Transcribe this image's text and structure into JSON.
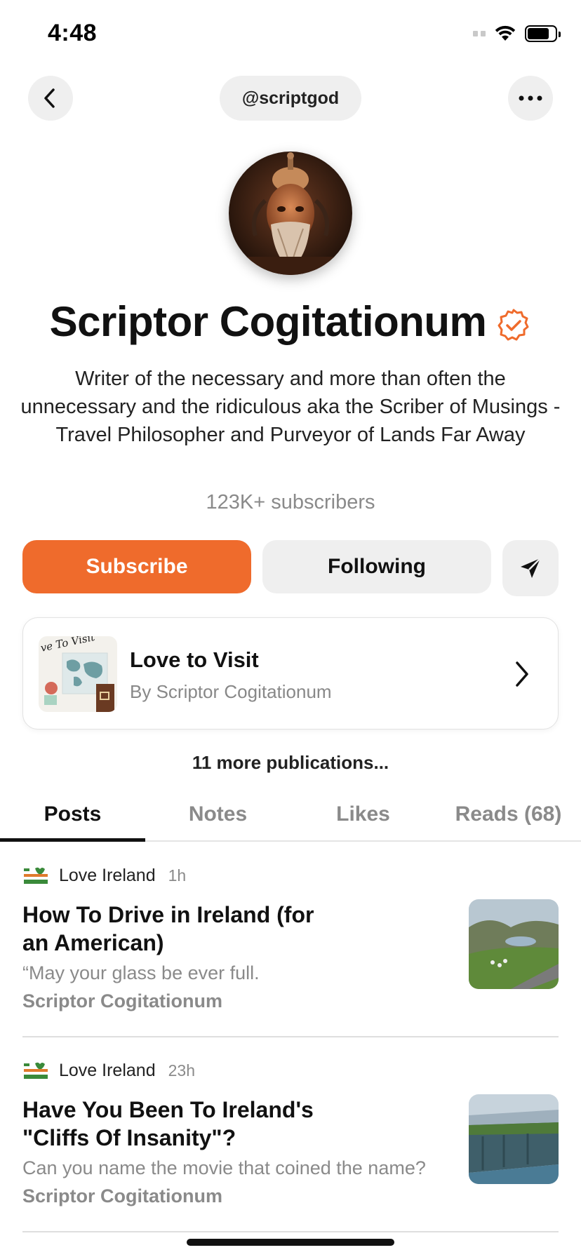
{
  "status_bar": {
    "time": "4:48"
  },
  "nav": {
    "handle": "@scriptgod"
  },
  "profile": {
    "name": "Scriptor Cogitationum",
    "bio": "Writer of the necessary and more than often the unnecessary and the ridiculous aka the Scriber of Musings - Travel Philosopher and Purveyor of Lands Far Away",
    "subscribers": "123K+ subscribers"
  },
  "actions": {
    "subscribe": "Subscribe",
    "following": "Following"
  },
  "publication": {
    "title": "Love to Visit",
    "byline": "By Scriptor Cogitationum",
    "thumb_text": "ve To Visit"
  },
  "more_publications": "11 more publications...",
  "tabs": [
    {
      "label": "Posts"
    },
    {
      "label": "Notes"
    },
    {
      "label": "Likes"
    },
    {
      "label": "Reads (68)"
    }
  ],
  "posts": [
    {
      "publication": "Love Ireland",
      "time": "1h",
      "title": "How To Drive in Ireland (for an American)",
      "subtitle": "“May your glass be ever full.",
      "author": "Scriptor Cogitationum"
    },
    {
      "publication": "Love Ireland",
      "time": "23h",
      "title": "Have You Been To Ireland's \"Cliffs Of Insanity\"?",
      "subtitle": "Can you name the movie that coined the name?",
      "author": "Scriptor Cogitationum"
    }
  ],
  "colors": {
    "accent": "#ef6b2c",
    "pill": "#efefef",
    "muted": "#8a8a8a"
  },
  "icons": [
    "back-chevron-icon",
    "more-dots-icon",
    "verified-check-icon",
    "send-arrow-icon",
    "chevron-right-icon",
    "wifi-icon",
    "battery-icon"
  ]
}
